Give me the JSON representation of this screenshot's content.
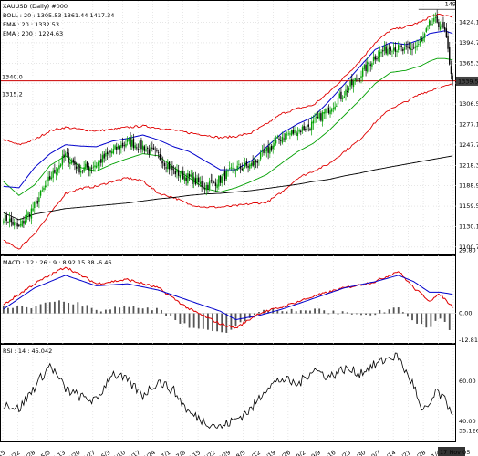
{
  "colors": {
    "bull": "#00a000",
    "bear": "#000000",
    "boll": "#e00000",
    "ema": "#0000cc",
    "ema200": "#000000",
    "hline": "#cc0000",
    "last_price_bg": "#444444",
    "grid": "#d8d8d8",
    "macd": "#e00000",
    "signal": "#0000cc",
    "hist": "#555555",
    "rsi": "#000000"
  },
  "chart_data": [
    {
      "type": "candlestick",
      "title": "XAUUSD (Daily) #000",
      "legend": [
        {
          "label": "BOLL : 20 : 1305.53 1361.44 1417.34",
          "color": "#e00000"
        },
        {
          "label": "EMA : 20 : 1332.53",
          "color": "#0000cc"
        },
        {
          "label": "EMA : 200 : 1224.63",
          "color": "#000000"
        }
      ],
      "ylim": [
        1090,
        1455
      ],
      "yticks": [
        "1424.1",
        "1394.7",
        "1365.3",
        "1336.8",
        "1306.5",
        "1277.1",
        "1247.7",
        "1218.3",
        "1188.9",
        "1159.5",
        "1130.1",
        "1100.7"
      ],
      "ytick_values": [
        1424.1,
        1394.7,
        1365.3,
        1336.8,
        1306.5,
        1277.1,
        1247.7,
        1218.3,
        1188.9,
        1159.5,
        1130.1,
        1100.7
      ],
      "horizontal_lines": [
        {
          "label": "1340.0",
          "value": 1340.0
        },
        {
          "label": "1315.2",
          "value": 1315.2
        }
      ],
      "last_price_label": "1339.5",
      "last_price": 1339.5,
      "top_annotation": "149",
      "keyframes": [
        [
          0,
          1145,
          1110,
          1195,
          1188,
          1255,
          1150
        ],
        [
          10,
          1128,
          1098,
          1175,
          1186,
          1248,
          1140
        ],
        [
          20,
          1160,
          1120,
          1190,
          1215,
          1255,
          1148
        ],
        [
          30,
          1200,
          1148,
          1218,
          1235,
          1268,
          1152
        ],
        [
          40,
          1232,
          1178,
          1232,
          1248,
          1273,
          1156
        ],
        [
          50,
          1212,
          1185,
          1215,
          1246,
          1270,
          1158
        ],
        [
          60,
          1220,
          1188,
          1210,
          1245,
          1268,
          1160
        ],
        [
          70,
          1238,
          1195,
          1220,
          1253,
          1270,
          1162
        ],
        [
          80,
          1252,
          1200,
          1228,
          1257,
          1273,
          1164
        ],
        [
          90,
          1245,
          1196,
          1235,
          1262,
          1275,
          1167
        ],
        [
          100,
          1232,
          1178,
          1232,
          1255,
          1272,
          1170
        ],
        [
          110,
          1210,
          1172,
          1215,
          1245,
          1269,
          1172
        ],
        [
          120,
          1200,
          1162,
          1200,
          1238,
          1265,
          1175
        ],
        [
          130,
          1188,
          1158,
          1185,
          1225,
          1262,
          1177
        ],
        [
          140,
          1198,
          1158,
          1180,
          1212,
          1258,
          1178
        ],
        [
          150,
          1214,
          1160,
          1186,
          1212,
          1260,
          1180
        ],
        [
          160,
          1218,
          1163,
          1195,
          1225,
          1265,
          1182
        ],
        [
          170,
          1238,
          1165,
          1205,
          1245,
          1278,
          1185
        ],
        [
          180,
          1260,
          1180,
          1222,
          1265,
          1293,
          1188
        ],
        [
          190,
          1268,
          1200,
          1238,
          1278,
          1300,
          1191
        ],
        [
          200,
          1278,
          1210,
          1250,
          1288,
          1305,
          1195
        ],
        [
          210,
          1300,
          1220,
          1268,
          1310,
          1323,
          1198
        ],
        [
          220,
          1322,
          1238,
          1290,
          1335,
          1345,
          1203
        ],
        [
          230,
          1348,
          1255,
          1312,
          1360,
          1368,
          1207
        ],
        [
          240,
          1375,
          1280,
          1336,
          1385,
          1395,
          1212
        ],
        [
          250,
          1390,
          1300,
          1352,
          1395,
          1413,
          1216
        ],
        [
          260,
          1382,
          1310,
          1355,
          1392,
          1418,
          1220
        ],
        [
          270,
          1395,
          1322,
          1362,
          1400,
          1425,
          1224
        ],
        [
          275,
          1420,
          1325,
          1368,
          1408,
          1432,
          1226
        ],
        [
          280,
          1426,
          1330,
          1372,
          1410,
          1435,
          1228
        ],
        [
          285,
          1410,
          1332,
          1372,
          1412,
          1434,
          1230
        ],
        [
          290,
          1339.5,
          1335,
          1370,
          1408,
          1433,
          1232
        ]
      ]
    },
    {
      "type": "line",
      "title": "MACD : 12 : 26 : 9 : 8.92 15.38 -6.46",
      "ylim": [
        -14,
        27
      ],
      "yticks": [
        "29.80",
        "0.00",
        "-12.81"
      ],
      "ytick_values": [
        29.8,
        0.0,
        -12.81
      ],
      "macd_keyframes": [
        [
          0,
          4
        ],
        [
          20,
          14
        ],
        [
          40,
          22
        ],
        [
          60,
          14
        ],
        [
          80,
          16
        ],
        [
          100,
          12
        ],
        [
          120,
          2
        ],
        [
          140,
          -5
        ],
        [
          150,
          -7
        ],
        [
          165,
          0
        ],
        [
          180,
          3
        ],
        [
          200,
          8
        ],
        [
          220,
          12
        ],
        [
          240,
          15
        ],
        [
          255,
          20
        ],
        [
          265,
          12
        ],
        [
          275,
          6
        ],
        [
          282,
          9
        ],
        [
          290,
          3
        ]
      ],
      "signal_keyframes": [
        [
          0,
          2
        ],
        [
          20,
          12
        ],
        [
          40,
          18
        ],
        [
          60,
          13
        ],
        [
          80,
          14
        ],
        [
          100,
          11
        ],
        [
          120,
          6
        ],
        [
          140,
          1
        ],
        [
          150,
          -3
        ],
        [
          165,
          -1
        ],
        [
          180,
          2
        ],
        [
          200,
          7
        ],
        [
          220,
          12
        ],
        [
          240,
          15
        ],
        [
          255,
          18
        ],
        [
          265,
          15
        ],
        [
          275,
          10
        ],
        [
          282,
          10
        ],
        [
          290,
          9
        ]
      ]
    },
    {
      "type": "line",
      "title": "RSI : 14 : 45.042",
      "ylim": [
        30,
        78
      ],
      "yticks": [
        "60.00",
        "40.00",
        "35.126"
      ],
      "ytick_values": [
        60.0,
        40.0,
        35.126
      ],
      "keyframes": [
        [
          0,
          49
        ],
        [
          10,
          46
        ],
        [
          20,
          57
        ],
        [
          30,
          68
        ],
        [
          40,
          56
        ],
        [
          50,
          52
        ],
        [
          60,
          50
        ],
        [
          70,
          64
        ],
        [
          80,
          60
        ],
        [
          90,
          53
        ],
        [
          100,
          60
        ],
        [
          110,
          55
        ],
        [
          120,
          44
        ],
        [
          130,
          40
        ],
        [
          140,
          37
        ],
        [
          150,
          41
        ],
        [
          160,
          46
        ],
        [
          170,
          57
        ],
        [
          180,
          61
        ],
        [
          190,
          58
        ],
        [
          200,
          66
        ],
        [
          210,
          62
        ],
        [
          220,
          66
        ],
        [
          230,
          64
        ],
        [
          240,
          68
        ],
        [
          250,
          72
        ],
        [
          255,
          72
        ],
        [
          260,
          64
        ],
        [
          265,
          58
        ],
        [
          270,
          44
        ],
        [
          275,
          48
        ],
        [
          280,
          55
        ],
        [
          285,
          50
        ],
        [
          290,
          45
        ]
      ]
    }
  ],
  "x_axis": {
    "labels": [
      "4/15",
      "4/22",
      "4/28",
      "5/6",
      "5/13",
      "5/20",
      "5/27",
      "6/3",
      "6/10",
      "6/17",
      "6/24",
      "7/1",
      "7/8",
      "7/15",
      "7/22",
      "7/29",
      "8/5",
      "8/12",
      "8/19",
      "8/26",
      "9/2",
      "9/9",
      "9/16",
      "9/23",
      "9/30",
      "10/7",
      "10/14",
      "10/21",
      "10/28",
      "11/4",
      "11/11"
    ],
    "current": "17 Nov 05"
  }
}
